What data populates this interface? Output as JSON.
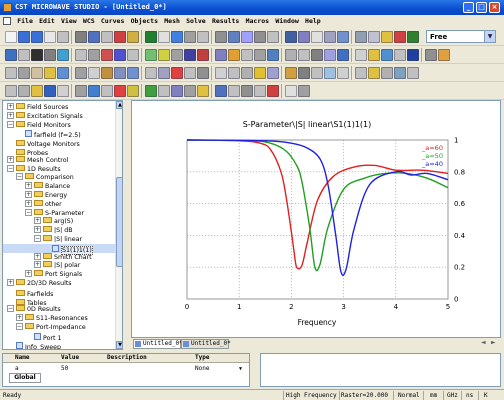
{
  "window": {
    "title": "CST MICROWAVE STUDIO - [Untitled_0*]",
    "minimize": "_",
    "maximize": "□",
    "close": "×"
  },
  "menu": [
    "File",
    "Edit",
    "View",
    "WCS",
    "Curves",
    "Objects",
    "Mesh",
    "Solve",
    "Results",
    "Macros",
    "Window",
    "Help"
  ],
  "toolbar": {
    "view_mode": "Free"
  },
  "tree": [
    {
      "label": "Field Sources",
      "level": 0,
      "exp": "+",
      "icon": "folder"
    },
    {
      "label": "Excitation Signals",
      "level": 0,
      "exp": "+",
      "icon": "folder"
    },
    {
      "label": "Field Monitors",
      "level": 0,
      "exp": "−",
      "icon": "folder"
    },
    {
      "label": "farfield (f=2.5)",
      "level": 1,
      "exp": "",
      "icon": "doc"
    },
    {
      "label": "Voltage Monitors",
      "level": 0,
      "exp": "",
      "icon": "folder"
    },
    {
      "label": "Probes",
      "level": 0,
      "exp": "",
      "icon": "folder"
    },
    {
      "label": "Mesh Control",
      "level": 0,
      "exp": "+",
      "icon": "folder"
    },
    {
      "label": "1D Results",
      "level": 0,
      "exp": "−",
      "icon": "folder"
    },
    {
      "label": "Comparison",
      "level": 1,
      "exp": "−",
      "icon": "folder"
    },
    {
      "label": "Balance",
      "level": 2,
      "exp": "+",
      "icon": "folder"
    },
    {
      "label": "Energy",
      "level": 2,
      "exp": "+",
      "icon": "folder"
    },
    {
      "label": "other",
      "level": 2,
      "exp": "+",
      "icon": "folder"
    },
    {
      "label": "S-Parameter",
      "level": 2,
      "exp": "−",
      "icon": "folder"
    },
    {
      "label": "arg(S)",
      "level": 3,
      "exp": "+",
      "icon": "folder"
    },
    {
      "label": "|S| dB",
      "level": 3,
      "exp": "+",
      "icon": "folder"
    },
    {
      "label": "|S| linear",
      "level": 3,
      "exp": "−",
      "icon": "folder"
    },
    {
      "label": "S1(1)1(1)",
      "level": 4,
      "exp": "",
      "icon": "doc",
      "selected": true
    },
    {
      "label": "Smith Chart",
      "level": 3,
      "exp": "+",
      "icon": "folder"
    },
    {
      "label": "|S| polar",
      "level": 3,
      "exp": "+",
      "icon": "folder"
    },
    {
      "label": "Port Signals",
      "level": 2,
      "exp": "+",
      "icon": "folder"
    },
    {
      "label": "2D/3D Results",
      "level": 0,
      "exp": "+",
      "icon": "folder"
    },
    {
      "label": "Farfields",
      "level": 0,
      "exp": "",
      "icon": "folder"
    },
    {
      "label": "Tables",
      "level": 0,
      "exp": "",
      "icon": "folder"
    },
    {
      "label": "0D Results",
      "level": 0,
      "exp": "−",
      "icon": "folder"
    },
    {
      "label": "S11-Resonances",
      "level": 1,
      "exp": "+",
      "icon": "folder"
    },
    {
      "label": "Port-Impedance",
      "level": 1,
      "exp": "−",
      "icon": "folder"
    },
    {
      "label": "Port 1",
      "level": 2,
      "exp": "",
      "icon": "doc"
    },
    {
      "label": "Info_Sweep",
      "level": 0,
      "exp": "",
      "icon": "doc"
    }
  ],
  "chart_data": {
    "type": "line",
    "title": "S-Parameter\\|S| linear\\S1(1)1(1)",
    "xlabel": "Frequency",
    "ylabel": "",
    "xlim": [
      0,
      5
    ],
    "ylim": [
      0,
      1
    ],
    "xticks": [
      "0",
      "1",
      "2",
      "3",
      "4",
      "5"
    ],
    "yticks": [
      "0",
      "0.2",
      "0.4",
      "0.6",
      "0.8",
      "1"
    ],
    "legend_position": "top-right",
    "series": [
      {
        "name": "_a=60",
        "color": "#e02020",
        "x": [
          0,
          1.0,
          1.4,
          1.6,
          1.8,
          1.9,
          2.0,
          2.05,
          2.1,
          2.2,
          2.3,
          2.5,
          2.8,
          3.2,
          3.6,
          4.0,
          4.5,
          5.0
        ],
        "y": [
          1,
          0.995,
          0.98,
          0.94,
          0.8,
          0.64,
          0.42,
          0.3,
          0.2,
          0.21,
          0.35,
          0.62,
          0.77,
          0.83,
          0.84,
          0.81,
          0.81,
          0.79
        ]
      },
      {
        "name": "_a=50",
        "color": "#20a020",
        "x": [
          0,
          1.2,
          1.6,
          1.9,
          2.1,
          2.2,
          2.35,
          2.45,
          2.55,
          2.7,
          3.0,
          3.4,
          3.8,
          4.2,
          4.6,
          5.0
        ],
        "y": [
          1,
          0.995,
          0.98,
          0.93,
          0.84,
          0.74,
          0.45,
          0.2,
          0.22,
          0.45,
          0.69,
          0.76,
          0.79,
          0.79,
          0.76,
          0.7
        ]
      },
      {
        "name": "_a=40",
        "color": "#2020e0",
        "x": [
          0,
          1.5,
          2.0,
          2.3,
          2.55,
          2.7,
          2.85,
          2.95,
          3.05,
          3.2,
          3.5,
          4.0,
          4.3,
          4.6,
          5.0
        ],
        "y": [
          1,
          0.995,
          0.98,
          0.95,
          0.88,
          0.72,
          0.4,
          0.17,
          0.19,
          0.44,
          0.72,
          0.8,
          0.78,
          0.79,
          0.75
        ]
      }
    ]
  },
  "plot_tabs": [
    "Untitled_0*",
    "Untitled_0*"
  ],
  "param_table": {
    "headers": [
      "Name",
      "Value",
      "Description",
      "Type"
    ],
    "row": {
      "name": "a",
      "value": "50",
      "description": "",
      "type": "None"
    },
    "tab": "Global"
  },
  "status": {
    "ready": "Ready",
    "mode": "High Frequency",
    "raster": "Raster=20.000",
    "state": "Normal",
    "unit1": "mm",
    "unit2": "GHz",
    "unit3": "ns",
    "unit4": "K"
  }
}
